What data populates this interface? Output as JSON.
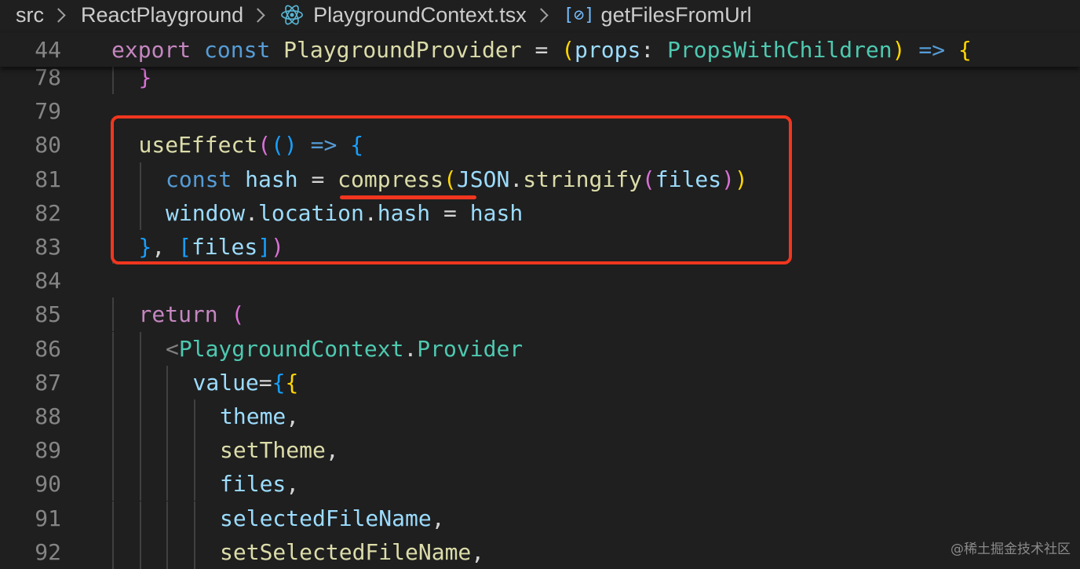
{
  "breadcrumb": {
    "items": [
      "src",
      "ReactPlayground",
      "PlaygroundContext.tsx",
      "getFilesFromUrl"
    ]
  },
  "editor": {
    "sticky": {
      "number": "44",
      "tokens": [
        [
          "export",
          "kw-purple"
        ],
        [
          " ",
          ""
        ],
        [
          "const",
          "kw-blue"
        ],
        [
          " ",
          ""
        ],
        [
          "PlaygroundProvider",
          "fn"
        ],
        [
          " = ",
          "punc"
        ],
        [
          "(",
          "b1"
        ],
        [
          "props",
          "var"
        ],
        [
          ": ",
          "punc"
        ],
        [
          "PropsWithChildren",
          "type"
        ],
        [
          ")",
          "b1"
        ],
        [
          " ",
          ""
        ],
        [
          "=>",
          "kw-blue"
        ],
        [
          " ",
          ""
        ],
        [
          "{",
          "b1"
        ]
      ]
    },
    "lines": [
      {
        "number": "78",
        "indent": 1,
        "tokens": [
          [
            "}",
            "b2"
          ]
        ]
      },
      {
        "number": "79",
        "indent": 0,
        "tokens": []
      },
      {
        "number": "80",
        "indent": 1,
        "tokens": [
          [
            "useEffect",
            "fn"
          ],
          [
            "(",
            "b2"
          ],
          [
            "()",
            "b3"
          ],
          [
            " ",
            ""
          ],
          [
            "=>",
            "kw-blue"
          ],
          [
            " ",
            ""
          ],
          [
            "{",
            "b3"
          ]
        ]
      },
      {
        "number": "81",
        "indent": 2,
        "tokens": [
          [
            "const",
            "kw-blue"
          ],
          [
            " ",
            ""
          ],
          [
            "hash",
            "var"
          ],
          [
            " = ",
            "punc"
          ],
          [
            "compress",
            "fn"
          ],
          [
            "(",
            "b1"
          ],
          [
            "JSON",
            "var"
          ],
          [
            ".",
            "punc"
          ],
          [
            "stringify",
            "fn"
          ],
          [
            "(",
            "b2"
          ],
          [
            "files",
            "var"
          ],
          [
            ")",
            "b2"
          ],
          [
            ")",
            "b1"
          ]
        ]
      },
      {
        "number": "82",
        "indent": 2,
        "tokens": [
          [
            "window",
            "var"
          ],
          [
            ".",
            "punc"
          ],
          [
            "location",
            "var"
          ],
          [
            ".",
            "punc"
          ],
          [
            "hash",
            "var"
          ],
          [
            " = ",
            "punc"
          ],
          [
            "hash",
            "var"
          ]
        ]
      },
      {
        "number": "83",
        "indent": 1,
        "tokens": [
          [
            "}",
            "b3"
          ],
          [
            ", ",
            "punc"
          ],
          [
            "[",
            "b3"
          ],
          [
            "files",
            "var"
          ],
          [
            "]",
            "b3"
          ],
          [
            ")",
            "b2"
          ]
        ]
      },
      {
        "number": "84",
        "indent": 0,
        "tokens": []
      },
      {
        "number": "85",
        "indent": 1,
        "tokens": [
          [
            "return",
            "kw-purple"
          ],
          [
            " ",
            ""
          ],
          [
            "(",
            "b2"
          ]
        ]
      },
      {
        "number": "86",
        "indent": 2,
        "tokens": [
          [
            "<",
            "tagp"
          ],
          [
            "PlaygroundContext",
            "cls"
          ],
          [
            ".",
            "punc"
          ],
          [
            "Provider",
            "cls"
          ]
        ]
      },
      {
        "number": "87",
        "indent": 3,
        "tokens": [
          [
            "value",
            "var"
          ],
          [
            "=",
            "punc"
          ],
          [
            "{",
            "b3"
          ],
          [
            "{",
            "b1"
          ]
        ]
      },
      {
        "number": "88",
        "indent": 4,
        "tokens": [
          [
            "theme",
            "var"
          ],
          [
            ",",
            "punc"
          ]
        ]
      },
      {
        "number": "89",
        "indent": 4,
        "tokens": [
          [
            "setTheme",
            "fn"
          ],
          [
            ",",
            "punc"
          ]
        ]
      },
      {
        "number": "90",
        "indent": 4,
        "tokens": [
          [
            "files",
            "var"
          ],
          [
            ",",
            "punc"
          ]
        ]
      },
      {
        "number": "91",
        "indent": 4,
        "tokens": [
          [
            "selectedFileName",
            "var"
          ],
          [
            ",",
            "punc"
          ]
        ]
      },
      {
        "number": "92",
        "indent": 4,
        "tokens": [
          [
            "setSelectedFileName",
            "fn"
          ],
          [
            ",",
            "punc"
          ]
        ]
      }
    ]
  },
  "watermark": "@稀土掘金技术社区",
  "colors": {
    "background": "#1f1f1f",
    "line_number": "#858585",
    "highlight": "#f0361f"
  }
}
